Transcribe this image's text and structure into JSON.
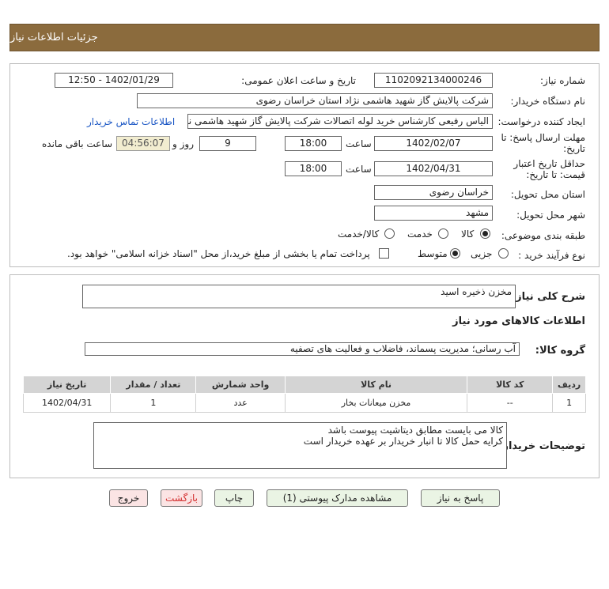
{
  "header": {
    "title": "جزئیات اطلاعات نیاز"
  },
  "fields": {
    "need_number_label": "شماره نیاز:",
    "need_number": "1102092134000246",
    "announce_label": "تاریخ و ساعت اعلان عمومی:",
    "announce_value": "1402/01/29 - 12:50",
    "buyer_org_label": "نام دستگاه خریدار:",
    "buyer_org": "شرکت پالایش گاز شهید هاشمی نژاد   استان خراسان رضوی",
    "creator_label": "ایجاد کننده درخواست:",
    "creator": "الیاس رفیعی کارشناس خرید لوله اتصالات شرکت پالایش گاز شهید هاشمی نژاد",
    "contact_link": "اطلاعات تماس خریدار",
    "deadline_label_1": "مهلت ارسال پاسخ: تا",
    "deadline_label_2": "تاریخ:",
    "deadline_date": "1402/02/07",
    "time_label": "ساعت",
    "deadline_time": "18:00",
    "days_value": "9",
    "days_label": "روز و",
    "remaining_time": "04:56:07",
    "remaining_label": "ساعت باقی مانده",
    "validity_label_1": "حداقل تاریخ اعتبار",
    "validity_label_2": "قیمت: تا تاریخ:",
    "validity_date": "1402/04/31",
    "validity_time": "18:00",
    "province_label": "استان محل تحویل:",
    "province": "خراسان رضوی",
    "city_label": "شهر محل تحویل:",
    "city": "مشهد",
    "category_label": "طبقه بندی موضوعی:",
    "category_options": [
      "کالا",
      "خدمت",
      "کالا/خدمت"
    ],
    "process_label": "نوع فرآیند خرید :",
    "process_options": [
      "جزیی",
      "متوسط"
    ],
    "payment_note": "پرداخت تمام یا بخشی از مبلغ خرید،از محل \"اسناد خزانه اسلامی\" خواهد بود."
  },
  "summary": {
    "label": "شرح کلی نیاز:",
    "value": "مخزن ذخیره اسید"
  },
  "goods_info_title": "اطلاعات کالاهای مورد نیاز",
  "goods_group": {
    "label": "گروه کالا:",
    "value": "آب رسانی؛ مدیریت پسماند، فاضلاب و فعالیت های تصفیه"
  },
  "table": {
    "headers": [
      "ردیف",
      "کد کالا",
      "نام کالا",
      "واحد شمارش",
      "تعداد / مقدار",
      "تاریخ نیاز"
    ],
    "rows": [
      [
        "1",
        "--",
        "مخزن میعانات بخار",
        "عدد",
        "1",
        "1402/04/31"
      ]
    ]
  },
  "buyer_notes": {
    "label": "توضیحات خریدار:",
    "line1": "کالا می بایست مطابق دیتاشیت پیوست باشد",
    "line2": "کرایه حمل کالا تا انبار خریدار بر عهده خریدار است"
  },
  "buttons": {
    "reply": "پاسخ به نیاز",
    "attachments": "مشاهده مدارک پیوستی (1)",
    "print": "چاپ",
    "back": "بازگشت",
    "exit": "خروج"
  }
}
